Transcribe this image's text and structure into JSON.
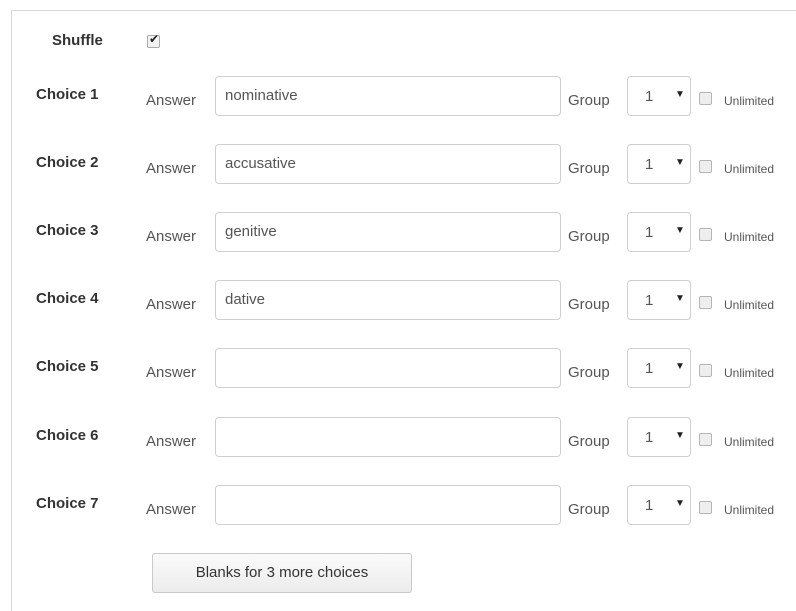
{
  "shuffle": {
    "label": "Shuffle",
    "checked": true
  },
  "choices": [
    {
      "label": "Choice 1",
      "answer_label": "Answer",
      "answer": "nominative",
      "group_label": "Group",
      "group": "1",
      "unlimited_label": "Unlimited",
      "unlimited": false
    },
    {
      "label": "Choice 2",
      "answer_label": "Answer",
      "answer": "accusative",
      "group_label": "Group",
      "group": "1",
      "unlimited_label": "Unlimited",
      "unlimited": false
    },
    {
      "label": "Choice 3",
      "answer_label": "Answer",
      "answer": "genitive",
      "group_label": "Group",
      "group": "1",
      "unlimited_label": "Unlimited",
      "unlimited": false
    },
    {
      "label": "Choice 4",
      "answer_label": "Answer",
      "answer": "dative",
      "group_label": "Group",
      "group": "1",
      "unlimited_label": "Unlimited",
      "unlimited": false
    },
    {
      "label": "Choice 5",
      "answer_label": "Answer",
      "answer": "",
      "group_label": "Group",
      "group": "1",
      "unlimited_label": "Unlimited",
      "unlimited": false
    },
    {
      "label": "Choice 6",
      "answer_label": "Answer",
      "answer": "",
      "group_label": "Group",
      "group": "1",
      "unlimited_label": "Unlimited",
      "unlimited": false
    },
    {
      "label": "Choice 7",
      "answer_label": "Answer",
      "answer": "",
      "group_label": "Group",
      "group": "1",
      "unlimited_label": "Unlimited",
      "unlimited": false
    }
  ],
  "blanks_button": {
    "label": "Blanks for 3 more choices"
  }
}
